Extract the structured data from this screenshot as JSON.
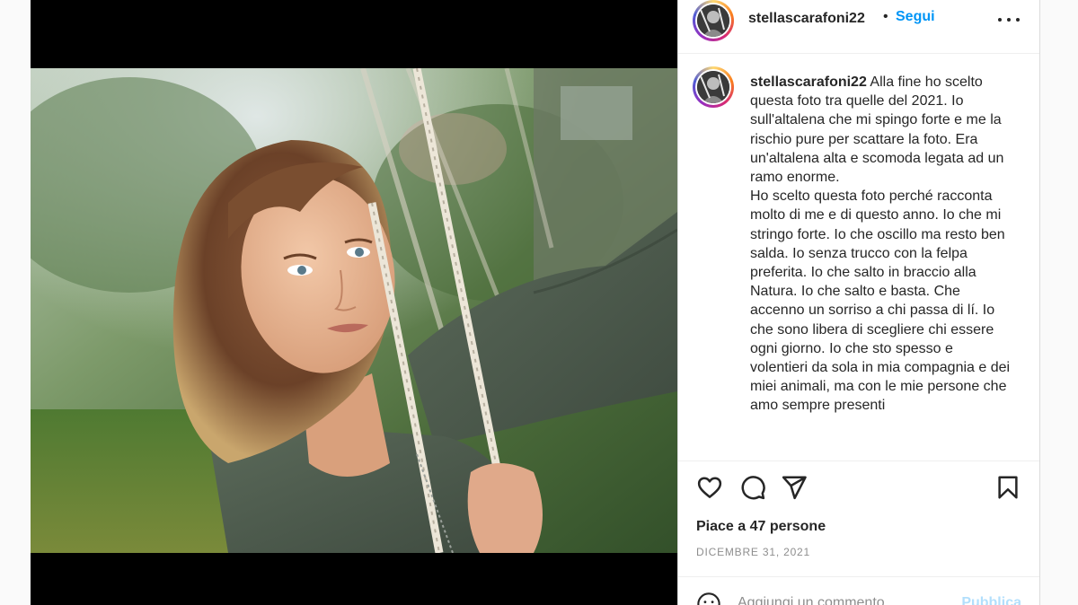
{
  "post": {
    "username": "stellascarafoni22",
    "separator": "•",
    "follow_label": "Segui",
    "caption": " Alla fine ho scelto questa foto tra quelle del 2021. Io sull'altalena che mi spingo forte e me la rischio pure per scattare la foto. Era un'altalena alta e scomoda legata ad un ramo enorme.\nHo scelto questa foto perché racconta molto di me e di questo anno. Io che mi stringo forte. Io che oscillo ma resto ben salda. Io senza trucco con la felpa preferita. Io che salto in braccio alla Natura. Io che salto e basta. Che accenno un sorriso a chi passa di lí. Io che sono libera di scegliere chi essere ogni giorno. Io che sto spesso e volentieri da sola in mia compagnia e dei miei animali, ma con le mie persone che amo sempre presenti",
    "likes_text": "Piace a 47 persone",
    "date_text": "DICEMBRE 31, 2021"
  },
  "comment_box": {
    "placeholder": "Aggiungi un commento...",
    "publish_label": "Pubblica"
  },
  "icons": {
    "more": "more-options-icon",
    "like": "heart-icon",
    "comment": "comment-bubble-icon",
    "share": "paper-plane-icon",
    "save": "bookmark-icon",
    "emoji": "smiley-icon"
  },
  "colors": {
    "accent": "#0095f6",
    "text": "#262626",
    "muted": "#8e8e8e",
    "publish_disabled": "#b2dffc"
  }
}
